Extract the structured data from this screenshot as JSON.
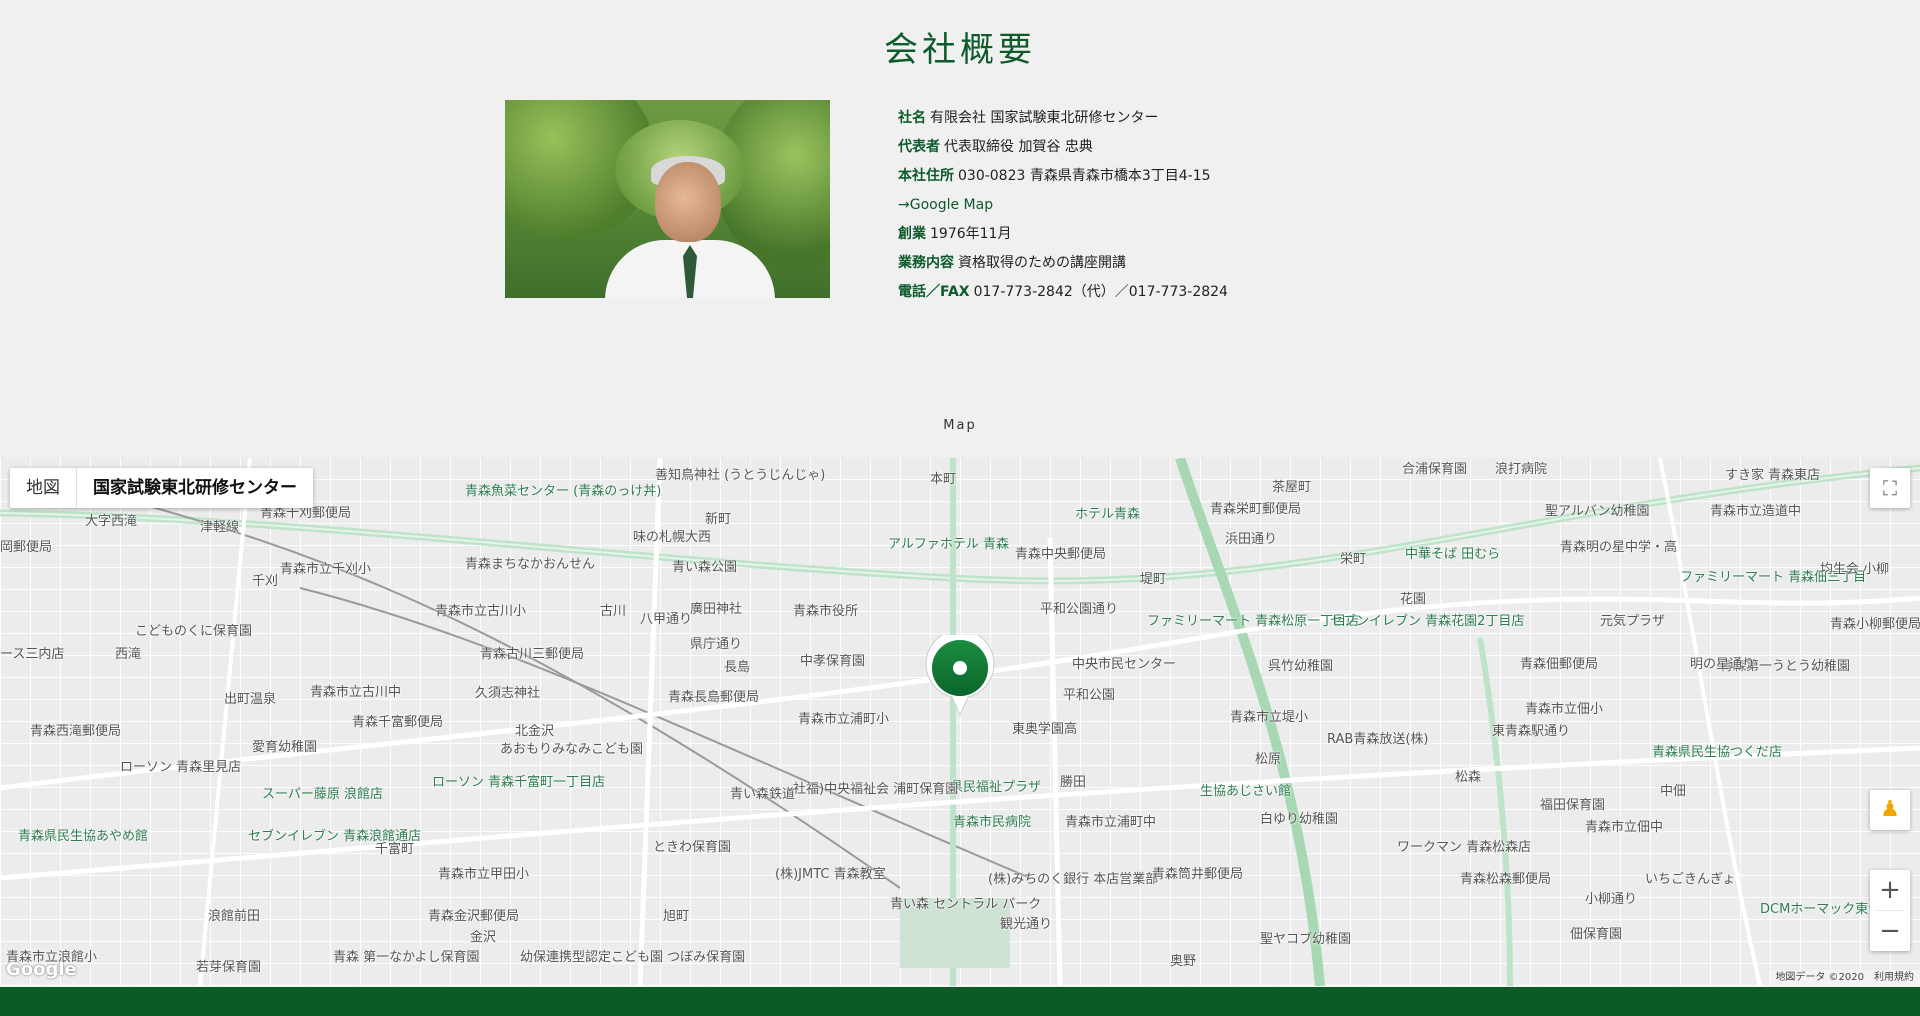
{
  "section": {
    "title": "会社概要",
    "map_heading": "Map"
  },
  "company": {
    "rows": [
      {
        "label": "社名",
        "value": "有限会社 国家試験東北研修センター"
      },
      {
        "label": "代表者",
        "value": "代表取締役 加賀谷 忠典"
      },
      {
        "label": "本社住所",
        "value": "030-0823 青森県青森市橋本3丁目4-15"
      },
      {
        "label": "創業",
        "value": "1976年11月"
      },
      {
        "label": "業務内容",
        "value": "資格取得のための講座開講"
      },
      {
        "label": "電話／FAX",
        "value": "017-773-2842（代）／017-773-2824"
      }
    ],
    "map_link": "→Google Map"
  },
  "map": {
    "type_buttons": [
      "地図",
      "国家試験東北研修センター"
    ],
    "zoom_in": "+",
    "zoom_out": "−",
    "logo": "Google",
    "attribution": "地図データ ©2020　利用規約",
    "pois": [
      "善知鳥神社 (うとうじんじゃ)",
      "本町",
      "茶屋町",
      "合浦保育園",
      "浪打病院",
      "すき家 青森東店",
      "青森魚菜センター (青森のっけ丼)",
      "ホテル青森",
      "青森栄町郵便局",
      "聖アルバン幼稚園",
      "青森市立造道中",
      "青森千刈郵便局",
      "味の札幌大西",
      "アルファホテル 青森",
      "青森中央郵便局",
      "中華そば 田むら",
      "青森明の星中学・高",
      "大字西滝",
      "津軽線",
      "千刈",
      "新町",
      "堤町",
      "栄町",
      "ファミリーマート 青森佃三丁目",
      "均生会 小柳",
      "岡郵便局",
      "青森市立千刈小",
      "青森まちなかおんせん",
      "青い森公園",
      "花園",
      "元気プラザ",
      "青森市立古川小",
      "古川",
      "廣田神社",
      "青森市役所",
      "ファミリーマート 青森松原一丁目店",
      "セブンイレブン 青森花園2丁目店",
      "青森小柳郵便局",
      "ース三内店",
      "西滝",
      "こどものくに保育園",
      "青森古川三郵便局",
      "中央市民センター",
      "呉竹幼稚園",
      "中孝保育園",
      "長島",
      "平和公園",
      "青森佃郵便局",
      "青森第一うとう幼稚園",
      "出町温泉",
      "青森市立古川中",
      "久須志神社",
      "青森長島郵便局",
      "青森市立浦町小",
      "東奥学園高",
      "青森市立堤小",
      "青森市立佃小",
      "青森西滝郵便局",
      "青森千富郵便局",
      "北金沢",
      "松原",
      "RAB青森放送(株)",
      "愛育幼稚園",
      "あおもりみなみこども園",
      "青森県民生協つくだ店",
      "ローソン 青森里見店",
      "県民福祉プラザ",
      "勝田",
      "生協あじさい館",
      "松森",
      "福田保育園",
      "中佃",
      "スーパー藤原 浪館店",
      "ローソン 青森千富町一丁目店",
      "社福)中央福祉会 浦町保育園",
      "青森市民病院",
      "青森市立浦町中",
      "白ゆり幼稚園",
      "青森市立佃中",
      "青森県民生協あやめ館",
      "セブンイレブン 青森浪館通店",
      "千富町",
      "ときわ保育園",
      "ワークマン 青森松森店",
      "青森市立甲田小",
      "(株)JMTC 青森教室",
      "(株)みちのく銀行 本店営業部",
      "青森筒井郵便局",
      "青森松森郵便局",
      "いちごきんぎょ",
      "DCMホーマック東青森店",
      "浪館前田",
      "青森金沢郵便局",
      "旭町",
      "青い森 セントラル パーク",
      "聖ヤコブ幼稚園",
      "佃保育園",
      "青森市立浪館小",
      "若芽保育園",
      "青森 第一なかよし保育園",
      "幼保連携型認定こども園 つぼみ保育園",
      "奥野",
      "八甲通り",
      "県庁通り",
      "平和公園通り",
      "観光通り",
      "東青森駅通り",
      "浜田通り",
      "小柳通り",
      "明の星通り",
      "青い森鉄道",
      "金沢"
    ]
  },
  "colors": {
    "brand_green": "#0d5a2a",
    "footer_green": "#0c5a26"
  }
}
